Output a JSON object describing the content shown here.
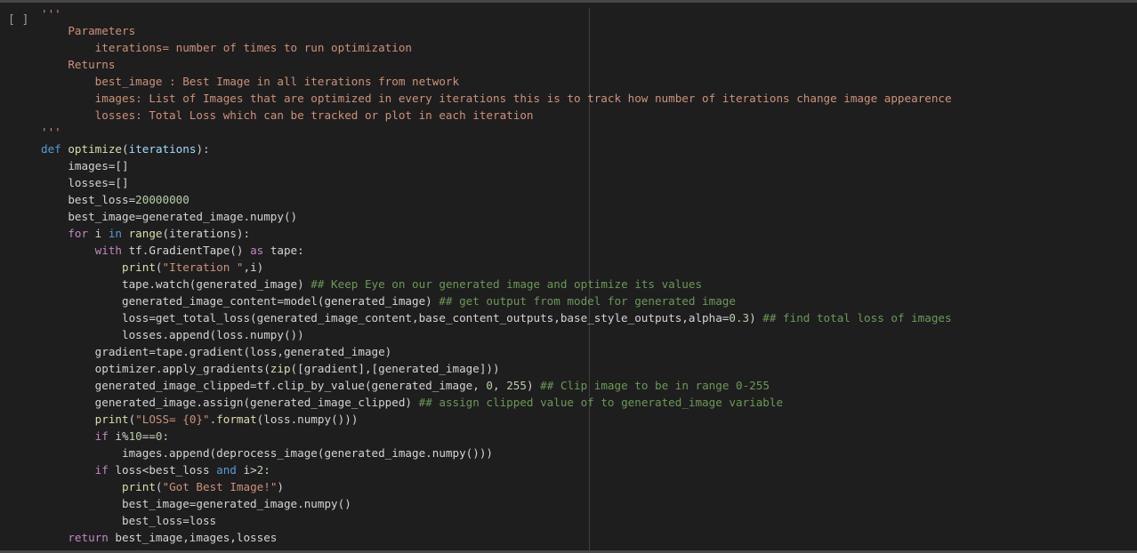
{
  "cell": {
    "run_indicator": "[ ]"
  },
  "code_lines": [
    [
      [
        "str",
        "'''"
      ]
    ],
    [
      [
        "str",
        "    Parameters"
      ]
    ],
    [
      [
        "str",
        "        iterations= number of times to run optimization"
      ]
    ],
    [
      [
        "str",
        "    Returns"
      ]
    ],
    [
      [
        "str",
        "        best_image : Best Image in all iterations from network"
      ]
    ],
    [
      [
        "str",
        "        images: List of Images that are optimized in every iterations this is to track how number of iterations change image appearence"
      ]
    ],
    [
      [
        "str",
        "        losses: Total Loss which can be tracked or plot in each iteration"
      ]
    ],
    [
      [
        "str",
        "'''"
      ]
    ],
    [
      [
        "kw",
        "def "
      ],
      [
        "fn",
        "optimize"
      ],
      [
        "pl",
        "("
      ],
      [
        "var",
        "iterations"
      ],
      [
        "pl",
        "):"
      ]
    ],
    [
      [
        "pl",
        "    images=[]"
      ]
    ],
    [
      [
        "pl",
        "    losses=[]"
      ]
    ],
    [
      [
        "pl",
        "    best_loss="
      ],
      [
        "num",
        "20000000"
      ]
    ],
    [
      [
        "pl",
        "    best_image=generated_image.numpy()"
      ]
    ],
    [
      [
        "flow",
        "    for "
      ],
      [
        "pl",
        "i "
      ],
      [
        "kw",
        "in "
      ],
      [
        "fn",
        "range"
      ],
      [
        "pl",
        "(iterations):"
      ]
    ],
    [
      [
        "flow",
        "        with "
      ],
      [
        "pl",
        "tf.GradientTape() "
      ],
      [
        "flow",
        "as "
      ],
      [
        "pl",
        "tape:"
      ]
    ],
    [
      [
        "fn",
        "            print"
      ],
      [
        "pl",
        "("
      ],
      [
        "str",
        "\"Iteration \""
      ],
      [
        "pl",
        ",i)"
      ]
    ],
    [
      [
        "pl",
        "            tape.watch(generated_image) "
      ],
      [
        "cm",
        "## Keep Eye on our generated image and optimize its values"
      ]
    ],
    [
      [
        "pl",
        "            generated_image_content=model(generated_image) "
      ],
      [
        "cm",
        "## get output from model for generated image"
      ]
    ],
    [
      [
        "pl",
        "            loss=get_total_loss(generated_image_content,base_content_outputs,base_style_outputs,alpha="
      ],
      [
        "num",
        "0.3"
      ],
      [
        "pl",
        ") "
      ],
      [
        "cm",
        "## find total loss of images"
      ]
    ],
    [
      [
        "pl",
        "            losses.append(loss.numpy())"
      ]
    ],
    [
      [
        "pl",
        "        gradient=tape.gradient(loss,generated_image)"
      ]
    ],
    [
      [
        "pl",
        "        optimizer.apply_gradients("
      ],
      [
        "fn",
        "zip"
      ],
      [
        "pl",
        "([gradient],[generated_image]))"
      ]
    ],
    [
      [
        "pl",
        "        generated_image_clipped=tf.clip_by_value(generated_image, "
      ],
      [
        "num",
        "0"
      ],
      [
        "pl",
        ", "
      ],
      [
        "num",
        "255"
      ],
      [
        "pl",
        ") "
      ],
      [
        "cm",
        "## Clip image to be in range 0-255"
      ]
    ],
    [
      [
        "pl",
        "        generated_image.assign(generated_image_clipped) "
      ],
      [
        "cm",
        "## assign clipped value of to generated_image variable"
      ]
    ],
    [
      [
        "fn",
        "        print"
      ],
      [
        "pl",
        "("
      ],
      [
        "str",
        "\"LOSS= {0}\""
      ],
      [
        "pl",
        "."
      ],
      [
        "fn",
        "format"
      ],
      [
        "pl",
        "(loss.numpy()))"
      ]
    ],
    [
      [
        "flow",
        "        if "
      ],
      [
        "pl",
        "i%"
      ],
      [
        "num",
        "10"
      ],
      [
        "pl",
        "=="
      ],
      [
        "num",
        "0"
      ],
      [
        "pl",
        ":"
      ]
    ],
    [
      [
        "pl",
        "            images.append(deprocess_image(generated_image.numpy()))"
      ]
    ],
    [
      [
        "flow",
        "        if "
      ],
      [
        "pl",
        "loss<best_loss "
      ],
      [
        "kw",
        "and "
      ],
      [
        "pl",
        "i>"
      ],
      [
        "num",
        "2"
      ],
      [
        "pl",
        ":"
      ]
    ],
    [
      [
        "fn",
        "            print"
      ],
      [
        "pl",
        "("
      ],
      [
        "str",
        "\"Got Best Image!\""
      ],
      [
        "pl",
        ")"
      ]
    ],
    [
      [
        "pl",
        "            best_image=generated_image.numpy()"
      ]
    ],
    [
      [
        "pl",
        "            best_loss=loss"
      ]
    ],
    [
      [
        "flow",
        "    return "
      ],
      [
        "pl",
        "best_image,images,losses"
      ]
    ]
  ]
}
